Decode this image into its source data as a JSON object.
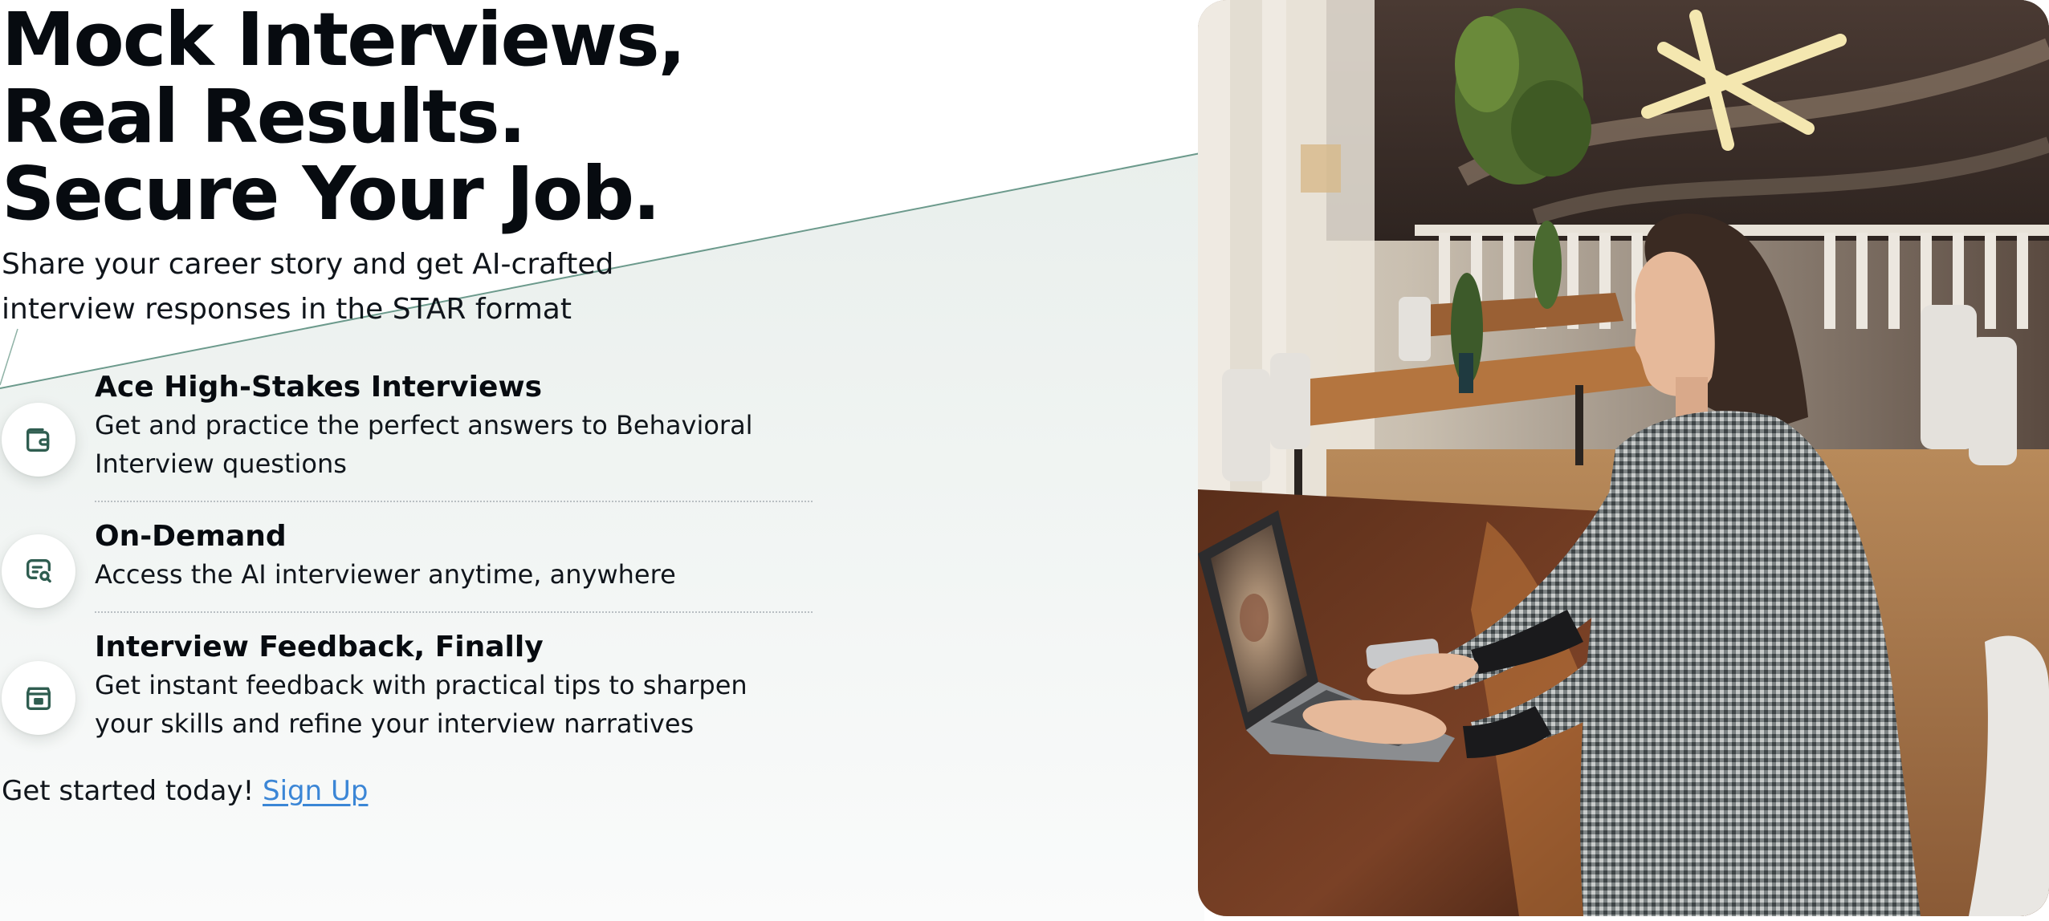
{
  "hero": {
    "headline": [
      "Mock Interviews,",
      "Real Results.",
      "Secure Your Job."
    ],
    "subtitle": "Share your career story and get AI-crafted interview responses in the STAR format"
  },
  "features": [
    {
      "icon": "wallet-icon",
      "title": "Ace High-Stakes Interviews",
      "description": "Get and practice the perfect answers to Behavioral Interview questions"
    },
    {
      "icon": "search-message-icon",
      "title": "On-Demand",
      "description": "Access the AI interviewer anytime, anywhere"
    },
    {
      "icon": "archive-box-icon",
      "title": "Interview Feedback, Finally",
      "description": "Get instant feedback with practical tips to sharpen your skills and refine your interview narratives"
    }
  ],
  "cta": {
    "prefix": "Get started today!",
    "link_label": "Sign Up"
  },
  "colors": {
    "icon_green": "#2f5d50",
    "link_blue": "#3b86d6",
    "headline": "#070b10"
  }
}
